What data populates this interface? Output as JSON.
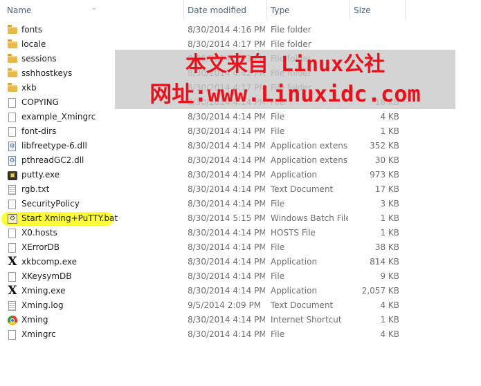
{
  "columns": {
    "name": "Name",
    "date": "Date modified",
    "type": "Type",
    "size": "Size"
  },
  "files": [
    {
      "name": "fonts",
      "date": "8/30/2014 4:16 PM",
      "type": "File folder",
      "size": "",
      "icon": "folder-icon"
    },
    {
      "name": "locale",
      "date": "8/30/2014 4:17 PM",
      "type": "File folder",
      "size": "",
      "icon": "folder-icon"
    },
    {
      "name": "sessions",
      "date": "8/30/2014 5:13 PM",
      "type": "File folder",
      "size": "",
      "icon": "folder-icon"
    },
    {
      "name": "sshhostkeys",
      "date": "8/30/2014 4:42 PM",
      "type": "File folder",
      "size": "",
      "icon": "folder-icon"
    },
    {
      "name": "xkb",
      "date": "8/30/2014 4:17 PM",
      "type": "File folder",
      "size": "",
      "icon": "folder-icon"
    },
    {
      "name": "COPYING",
      "date": "8/30/2014 4:14 PM",
      "type": "File",
      "size": "18 KB",
      "icon": "file-icon"
    },
    {
      "name": "example_Xmingrc",
      "date": "8/30/2014 4:14 PM",
      "type": "File",
      "size": "4 KB",
      "icon": "file-icon"
    },
    {
      "name": "font-dirs",
      "date": "8/30/2014 4:14 PM",
      "type": "File",
      "size": "1 KB",
      "icon": "file-icon"
    },
    {
      "name": "libfreetype-6.dll",
      "date": "8/30/2014 4:14 PM",
      "type": "Application extens...",
      "size": "352 KB",
      "icon": "dll-icon"
    },
    {
      "name": "pthreadGC2.dll",
      "date": "8/30/2014 4:14 PM",
      "type": "Application extens...",
      "size": "30 KB",
      "icon": "dll-icon"
    },
    {
      "name": "putty.exe",
      "date": "8/30/2014 4:14 PM",
      "type": "Application",
      "size": "973 KB",
      "icon": "putty-icon"
    },
    {
      "name": "rgb.txt",
      "date": "8/30/2014 4:14 PM",
      "type": "Text Document",
      "size": "17 KB",
      "icon": "text-doc-icon"
    },
    {
      "name": "SecurityPolicy",
      "date": "8/30/2014 4:14 PM",
      "type": "File",
      "size": "3 KB",
      "icon": "file-icon"
    },
    {
      "name": "Start Xming+PuTTY.bat",
      "date": "8/30/2014 5:15 PM",
      "type": "Windows Batch File",
      "size": "1 KB",
      "icon": "batch-file-icon",
      "highlight": "#fbfb3a"
    },
    {
      "name": "X0.hosts",
      "date": "8/30/2014 4:14 PM",
      "type": "HOSTS File",
      "size": "1 KB",
      "icon": "file-icon"
    },
    {
      "name": "XErrorDB",
      "date": "8/30/2014 4:14 PM",
      "type": "File",
      "size": "38 KB",
      "icon": "file-icon"
    },
    {
      "name": "xkbcomp.exe",
      "date": "8/30/2014 4:14 PM",
      "type": "Application",
      "size": "814 KB",
      "icon": "xming-x-icon"
    },
    {
      "name": "XKeysymDB",
      "date": "8/30/2014 4:14 PM",
      "type": "File",
      "size": "9 KB",
      "icon": "file-icon"
    },
    {
      "name": "Xming.exe",
      "date": "8/30/2014 4:14 PM",
      "type": "Application",
      "size": "2,057 KB",
      "icon": "xming-x-icon"
    },
    {
      "name": "Xming.log",
      "date": "9/5/2014 2:09 PM",
      "type": "Text Document",
      "size": "4 KB",
      "icon": "text-doc-icon"
    },
    {
      "name": "Xming",
      "date": "8/30/2014 4:14 PM",
      "type": "Internet Shortcut",
      "size": "1 KB",
      "icon": "internet-shortcut-icon"
    },
    {
      "name": "Xmingrc",
      "date": "8/30/2014 4:14 PM",
      "type": "File",
      "size": "4 KB",
      "icon": "file-icon"
    }
  ],
  "watermark": {
    "line1": "本文来自 Linux公社",
    "line2": "网址:www.Linuxidc.com",
    "color": "#e8121c"
  }
}
